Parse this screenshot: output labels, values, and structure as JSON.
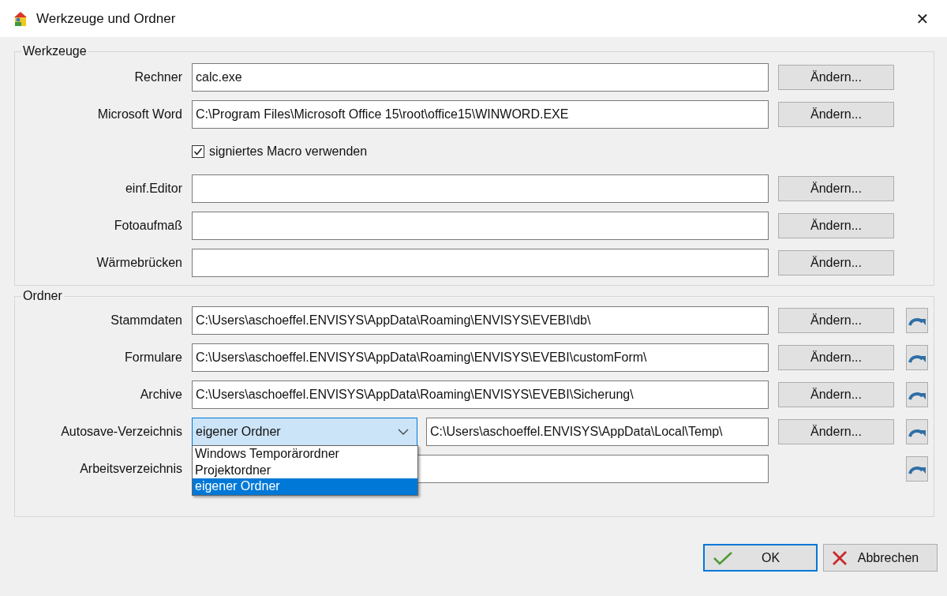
{
  "window": {
    "title": "Werkzeuge und Ordner",
    "close": "✕"
  },
  "groups": [
    {
      "title": "Werkzeuge",
      "kind": "tools",
      "rows": [
        {
          "kind": "field",
          "label": "Rechner",
          "value": "calc.exe",
          "button": "Ändern..."
        },
        {
          "kind": "field",
          "label": "Microsoft Word",
          "value": "C:\\Program Files\\Microsoft Office 15\\root\\office15\\WINWORD.EXE",
          "button": "Ändern..."
        },
        {
          "kind": "checkbox",
          "label": "signiertes Macro verwenden",
          "checked": true
        },
        {
          "kind": "field",
          "label": "einf.Editor",
          "button": "Ändern..."
        },
        {
          "kind": "field",
          "label": "Fotoaufmaß",
          "button": "Ändern..."
        },
        {
          "kind": "field",
          "label": "Wärmebrücken",
          "button": "Ändern..."
        }
      ]
    },
    {
      "title": "Ordner",
      "kind": "folders",
      "rows": [
        {
          "kind": "field",
          "label": "Stammdaten",
          "value": "C:\\Users\\aschoeffel.ENVISYS\\AppData\\Roaming\\ENVISYS\\EVEBI\\db\\",
          "button": "Ändern..."
        },
        {
          "kind": "field",
          "label": "Formulare",
          "value": "C:\\Users\\aschoeffel.ENVISYS\\AppData\\Roaming\\ENVISYS\\EVEBI\\customForm\\",
          "button": "Ändern..."
        },
        {
          "kind": "field",
          "label": "Archive",
          "value": "C:\\Users\\aschoeffel.ENVISYS\\AppData\\Roaming\\ENVISYS\\EVEBI\\Sicherung\\",
          "button": "Ändern..."
        },
        {
          "kind": "combo",
          "label": "Autosave-Verzeichnis",
          "value": "eigener Ordner",
          "expanded": true,
          "options": [
            {
              "label": "Windows Temporärordner",
              "selected": false
            },
            {
              "label": "Projektordner",
              "selected": false
            },
            {
              "label": "eigener Ordner",
              "selected": true
            }
          ],
          "path": "C:\\Users\\aschoeffel.ENVISYS\\AppData\\Local\\Temp\\",
          "button": "Ändern..."
        },
        {
          "kind": "field",
          "label": "Arbeitsverzeichnis"
        }
      ]
    }
  ],
  "buttons": [
    {
      "label": "OK",
      "kind": "ok"
    },
    {
      "label": "Abbrechen",
      "kind": "cancel"
    }
  ]
}
